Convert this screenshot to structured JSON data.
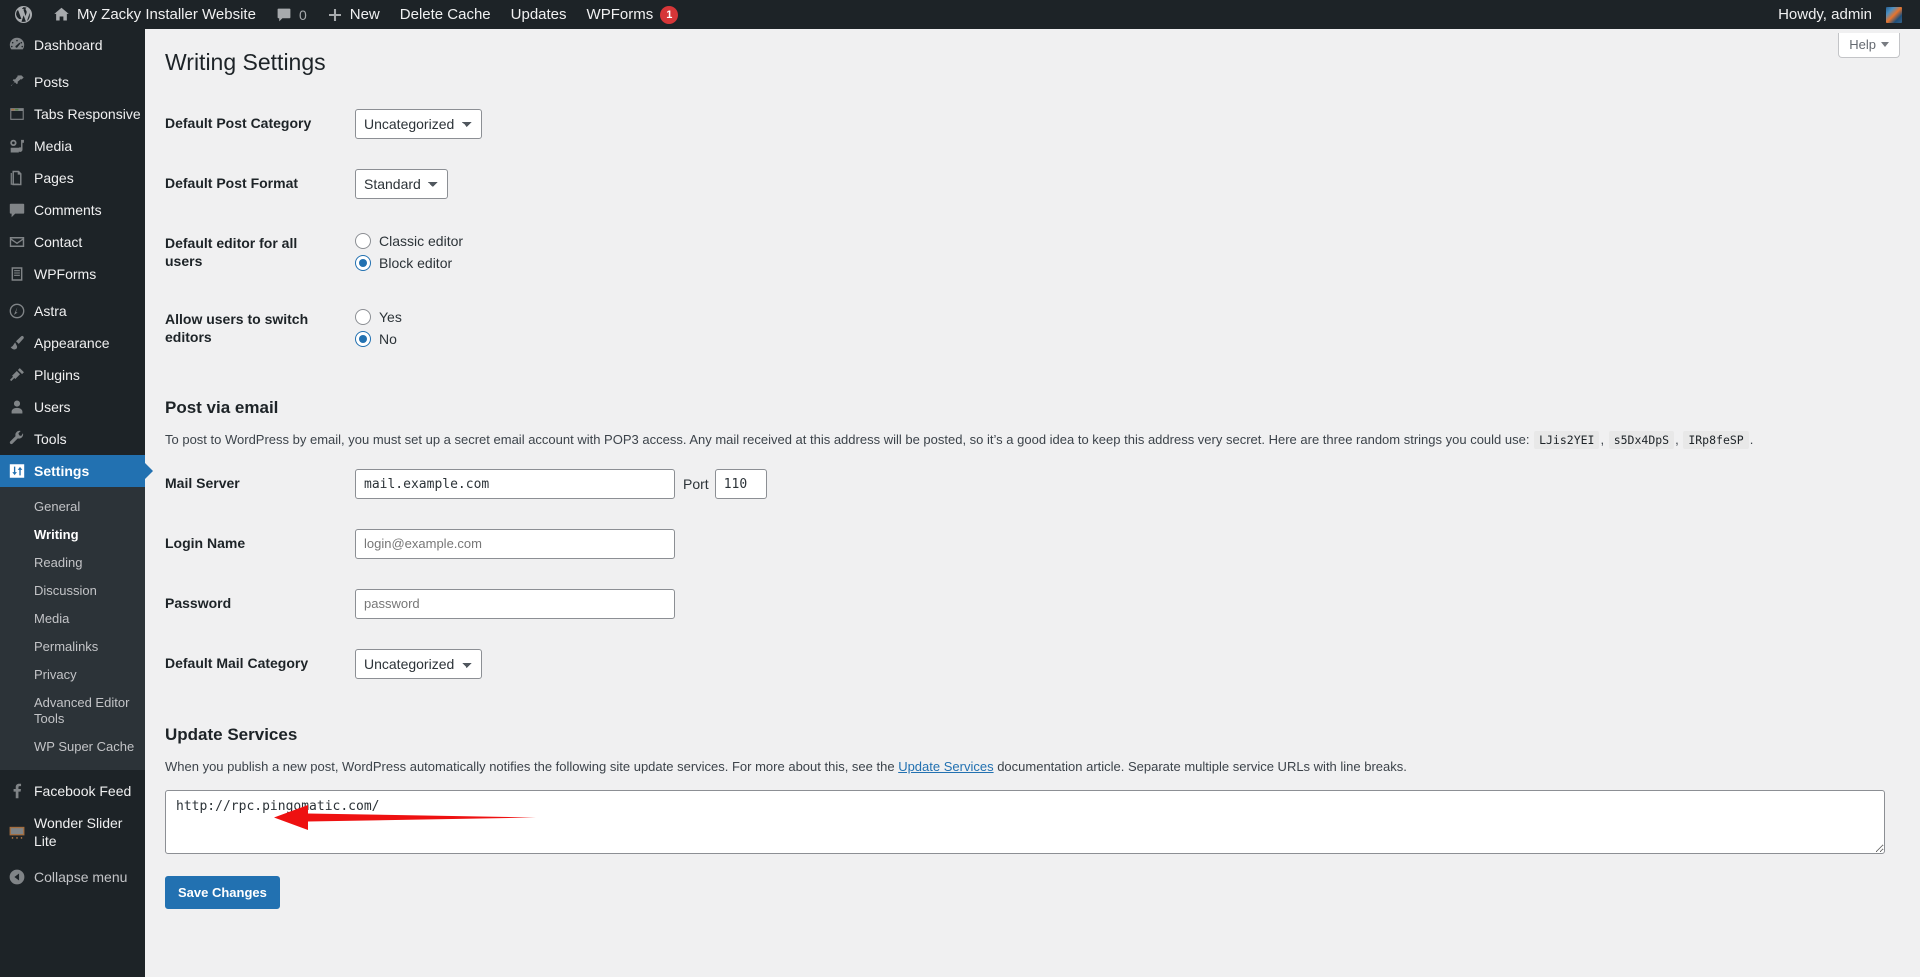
{
  "adminbar": {
    "wp_logo": "wordpress-logo-icon",
    "site_name": "My Zacky Installer Website",
    "comments_count": "0",
    "new_label": "New",
    "delete_cache_label": "Delete Cache",
    "updates_label": "Updates",
    "wpforms_label": "WPForms",
    "wpforms_badge": "1",
    "howdy": "Howdy, admin"
  },
  "sidebar": {
    "items": [
      {
        "label": "Dashboard",
        "icon": "dashboard-icon",
        "current": false,
        "sep_after": true
      },
      {
        "label": "Posts",
        "icon": "pin-icon",
        "current": false,
        "sep_after": false
      },
      {
        "label": "Tabs Responsive",
        "icon": "window-icon",
        "current": false,
        "sep_after": false
      },
      {
        "label": "Media",
        "icon": "media-icon",
        "current": false,
        "sep_after": false
      },
      {
        "label": "Pages",
        "icon": "pages-icon",
        "current": false,
        "sep_after": false
      },
      {
        "label": "Comments",
        "icon": "comment-icon",
        "current": false,
        "sep_after": false
      },
      {
        "label": "Contact",
        "icon": "envelope-icon",
        "current": false,
        "sep_after": false
      },
      {
        "label": "WPForms",
        "icon": "forms-icon",
        "current": false,
        "sep_after": true
      },
      {
        "label": "Astra",
        "icon": "astra-icon",
        "current": false,
        "sep_after": false
      },
      {
        "label": "Appearance",
        "icon": "brush-icon",
        "current": false,
        "sep_after": false
      },
      {
        "label": "Plugins",
        "icon": "plug-icon",
        "current": false,
        "sep_after": false
      },
      {
        "label": "Users",
        "icon": "user-icon",
        "current": false,
        "sep_after": false
      },
      {
        "label": "Tools",
        "icon": "wrench-icon",
        "current": false,
        "sep_after": false
      },
      {
        "label": "Settings",
        "icon": "settings-icon",
        "current": true,
        "sep_after": false
      }
    ],
    "settings_submenu": [
      {
        "label": "General",
        "current": false
      },
      {
        "label": "Writing",
        "current": true
      },
      {
        "label": "Reading",
        "current": false
      },
      {
        "label": "Discussion",
        "current": false
      },
      {
        "label": "Media",
        "current": false
      },
      {
        "label": "Permalinks",
        "current": false
      },
      {
        "label": "Privacy",
        "current": false
      },
      {
        "label": "Advanced Editor Tools",
        "current": false
      },
      {
        "label": "WP Super Cache",
        "current": false
      }
    ],
    "bottom_items": [
      {
        "label": "Facebook Feed",
        "icon": "facebook-icon"
      },
      {
        "label": "Wonder Slider Lite",
        "icon": "slider-icon"
      }
    ],
    "collapse_label": "Collapse menu",
    "collapse_icon": "collapse-arrow-icon"
  },
  "help": {
    "label": "Help"
  },
  "page": {
    "title": "Writing Settings",
    "fields": {
      "default_post_category_label": "Default Post Category",
      "default_post_category_value": "Uncategorized",
      "default_post_format_label": "Default Post Format",
      "default_post_format_value": "Standard",
      "default_editor_label": "Default editor for all users",
      "editor_classic_label": "Classic editor",
      "editor_block_label": "Block editor",
      "editor_selected": "Block editor",
      "switch_editors_label": "Allow users to switch editors",
      "switch_yes_label": "Yes",
      "switch_no_label": "No",
      "switch_selected": "No"
    },
    "post_via_email": {
      "heading": "Post via email",
      "description_before": "To post to WordPress by email, you must set up a secret email account with POP3 access. Any mail received at this address will be posted, so it’s a good idea to keep this address very secret. Here are three random strings you could use: ",
      "random_strings": [
        "LJis2YEI",
        "s5Dx4DpS",
        "IRp8feSP"
      ],
      "mail_server_label": "Mail Server",
      "mail_server_value": "mail.example.com",
      "port_label": "Port",
      "port_value": "110",
      "login_name_label": "Login Name",
      "login_name_placeholder": "login@example.com",
      "password_label": "Password",
      "password_placeholder": "password",
      "default_mail_category_label": "Default Mail Category",
      "default_mail_category_value": "Uncategorized"
    },
    "update_services": {
      "heading": "Update Services",
      "desc_part1": "When you publish a new post, WordPress automatically notifies the following site update services. For more about this, see the ",
      "link_text": "Update Services",
      "desc_part2": " documentation article. Separate multiple service URLs with line breaks.",
      "textarea_value": "http://rpc.pingomatic.com/"
    },
    "save_label": "Save Changes"
  },
  "annotation": {
    "arrow_color": "#ee1111",
    "name": "red-arrow-pointing-to-save-changes"
  }
}
